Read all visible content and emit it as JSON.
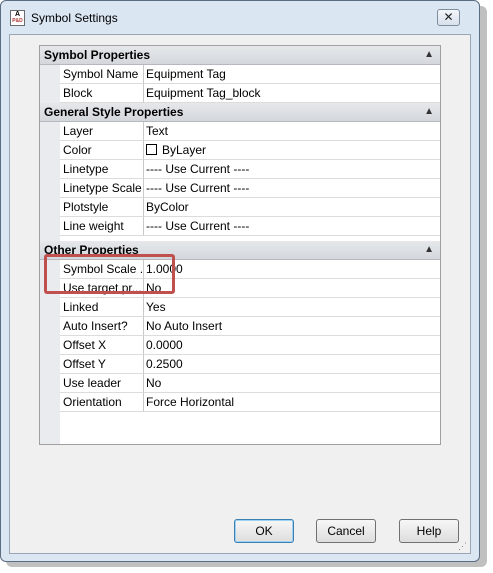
{
  "window": {
    "title": "Symbol Settings",
    "icon_text": "A",
    "icon_sub": "P&D",
    "close_glyph": "✕"
  },
  "sections": [
    {
      "title": "Symbol Properties",
      "collapse_glyph": "▲",
      "rows": [
        {
          "name": "Symbol Name",
          "value": "Equipment Tag"
        },
        {
          "name": "Block",
          "value": "Equipment Tag_block"
        }
      ]
    },
    {
      "title": "General Style Properties",
      "collapse_glyph": "▲",
      "rows": [
        {
          "name": "Layer",
          "value": "Text"
        },
        {
          "name": "Color",
          "value": "ByLayer",
          "swatch": "#ffffff"
        },
        {
          "name": "Linetype",
          "value": "---- Use Current ----"
        },
        {
          "name": "Linetype Scale",
          "value": "---- Use Current ----"
        },
        {
          "name": "Plotstyle",
          "value": "ByColor"
        },
        {
          "name": "Line weight",
          "value": "---- Use Current ----"
        }
      ]
    },
    {
      "title": "Other Properties",
      "collapse_glyph": "▲",
      "rows": [
        {
          "name": "Symbol Scale ...",
          "value": "1.0000"
        },
        {
          "name": "Use target pr...",
          "value": "No"
        },
        {
          "name": "Linked",
          "value": "Yes"
        },
        {
          "name": "Auto Insert?",
          "value": "No Auto Insert"
        },
        {
          "name": "Offset X",
          "value": "0.0000"
        },
        {
          "name": "Offset Y",
          "value": "0.2500"
        },
        {
          "name": "Use leader",
          "value": "No"
        },
        {
          "name": "Orientation",
          "value": "Force Horizontal"
        }
      ]
    }
  ],
  "buttons": {
    "ok": "OK",
    "cancel": "Cancel",
    "help": "Help"
  },
  "colors": {
    "highlight": "#c0504d",
    "title_bar": "#dbe6f3"
  }
}
